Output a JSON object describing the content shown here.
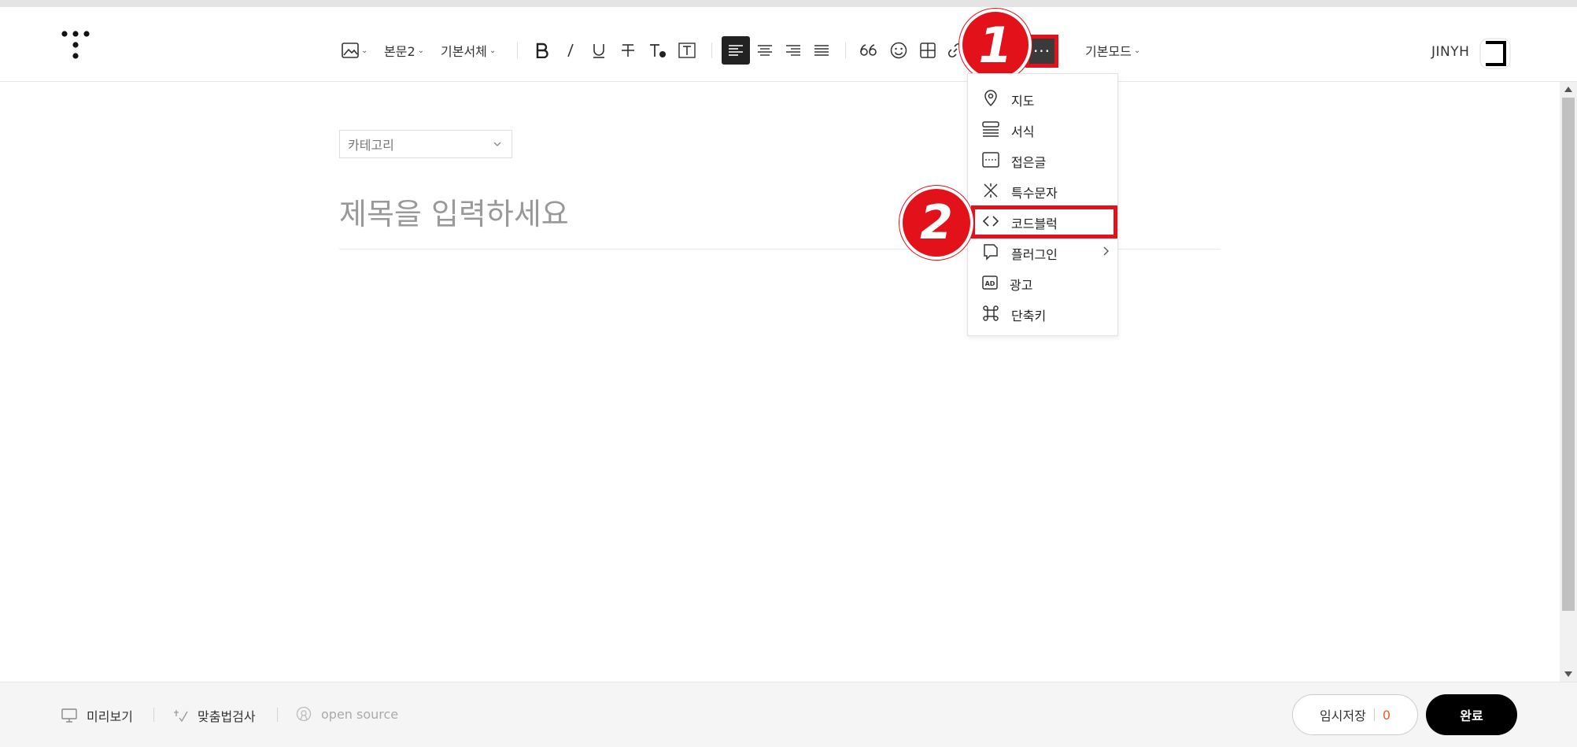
{
  "toolbar": {
    "paragraph_style": "본문2",
    "font_family": "기본서체",
    "mode": "기본모드",
    "more_label": "···"
  },
  "user": {
    "name": "JINYH"
  },
  "editor": {
    "category_label": "카테고리",
    "title_placeholder": "제목을 입력하세요"
  },
  "more_menu": {
    "items": [
      {
        "label": "지도",
        "icon": "map-pin-icon"
      },
      {
        "label": "서식",
        "icon": "format-icon"
      },
      {
        "label": "접은글",
        "icon": "folded-text-icon"
      },
      {
        "label": "특수문자",
        "icon": "special-char-icon"
      },
      {
        "label": "코드블럭",
        "icon": "code-icon"
      },
      {
        "label": "플러그인",
        "icon": "plugin-icon"
      },
      {
        "label": "광고",
        "icon": "ad-icon"
      },
      {
        "label": "단축키",
        "icon": "command-icon"
      }
    ]
  },
  "annotations": {
    "step1": "1",
    "step2": "2",
    "color": "#e3111a"
  },
  "footer": {
    "preview": "미리보기",
    "spellcheck": "맞춤법검사",
    "open_source": "open source",
    "temp_save": "임시저장",
    "temp_count": "0",
    "done": "완료"
  }
}
